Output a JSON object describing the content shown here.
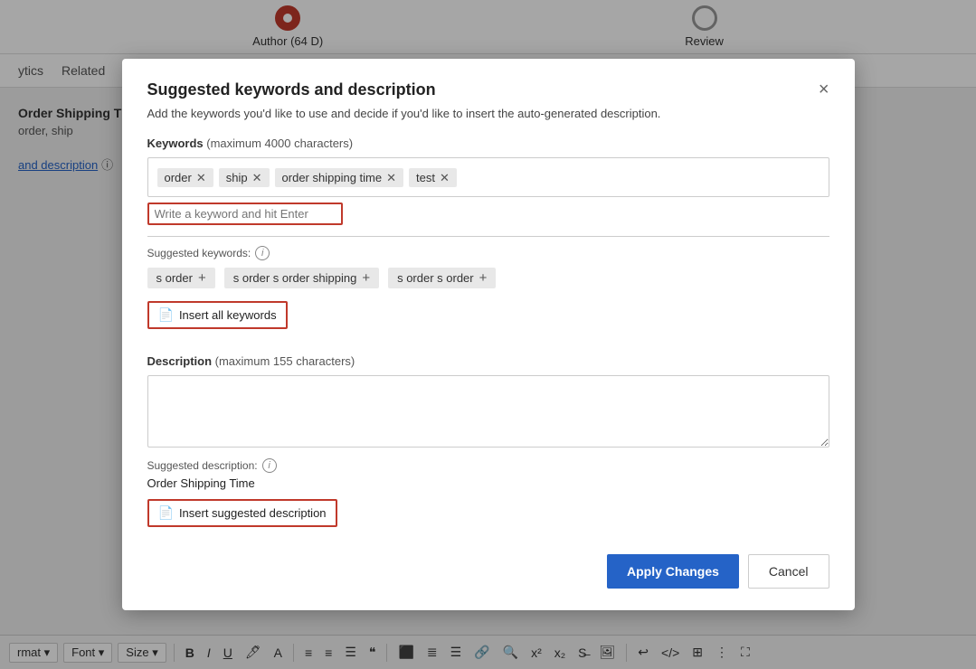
{
  "background": {
    "step1_label": "Author (64 D)",
    "step2_label": "Review",
    "nav_items": [
      "ytics",
      "Related"
    ],
    "left_title": "Order Shipping Time",
    "left_sub": "order, ship",
    "breadcrumb_text": "and description"
  },
  "modal": {
    "title": "Suggested keywords and description",
    "subtitle": "Add the keywords you'd like to use and decide if you'd like to insert the auto-generated description.",
    "close_label": "×",
    "keywords_section": {
      "label": "Keywords",
      "label_suffix": "(maximum 4000 characters)",
      "tags": [
        {
          "text": "order"
        },
        {
          "text": "ship"
        },
        {
          "text": "order shipping time"
        },
        {
          "text": "test"
        }
      ],
      "input_placeholder": "Write a keyword and hit Enter"
    },
    "suggested_keywords_label": "Suggested keywords:",
    "suggested_tags": [
      {
        "text": "s order"
      },
      {
        "text": "s order s order shipping"
      },
      {
        "text": "s order s order"
      }
    ],
    "insert_all_btn": "Insert all keywords",
    "description_section": {
      "label": "Description",
      "label_suffix": "(maximum 155 characters)",
      "placeholder": ""
    },
    "suggested_desc_label": "Suggested description:",
    "suggested_desc_text": "Order Shipping Time",
    "insert_desc_btn": "Insert suggested description",
    "footer": {
      "apply_label": "Apply Changes",
      "cancel_label": "Cancel"
    }
  },
  "toolbar": {
    "format_label": "rmat",
    "font_label": "Font",
    "size_label": "Size"
  }
}
